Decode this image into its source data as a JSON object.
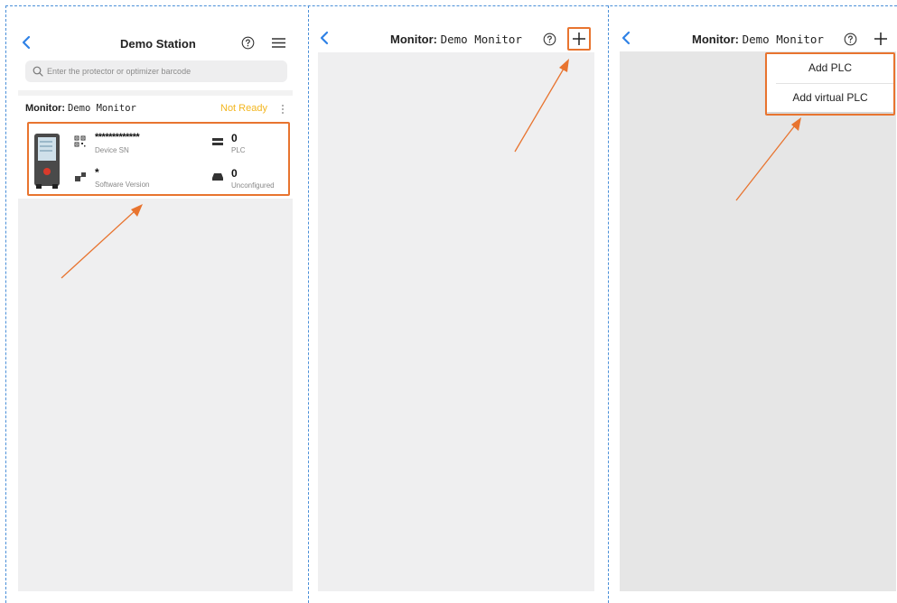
{
  "panel1": {
    "title": "Demo Station",
    "search_placeholder": "Enter the protector or optimizer barcode",
    "monitor_label": "Monitor:",
    "monitor_name": "Demo Monitor",
    "status": "Not Ready",
    "device_sn_value": "*************",
    "device_sn_label": "Device SN",
    "software_version_value": "*",
    "software_version_label": "Software Version",
    "plc_count": "0",
    "plc_label": "PLC",
    "unconfigured_count": "0",
    "unconfigured_label": "Unconfigured"
  },
  "panel2": {
    "monitor_label": "Monitor:",
    "monitor_name": "Demo Monitor"
  },
  "panel3": {
    "monitor_label": "Monitor:",
    "monitor_name": "Demo Monitor",
    "menu": [
      "Add PLC",
      "Add virtual PLC"
    ]
  },
  "colors": {
    "accent_blue": "#2f82e6",
    "status_yellow": "#f3b61f",
    "annotation_orange": "#e8742f",
    "divider_blue": "#4a8fd8",
    "content_gray": "#efeff0"
  },
  "icons": [
    "chevron-left-icon",
    "help-circle-icon",
    "hamburger-menu-icon",
    "plus-icon",
    "search-icon",
    "qr-code-icon",
    "network-icon",
    "plc-icon",
    "device-icon",
    "more-vertical-icon"
  ]
}
